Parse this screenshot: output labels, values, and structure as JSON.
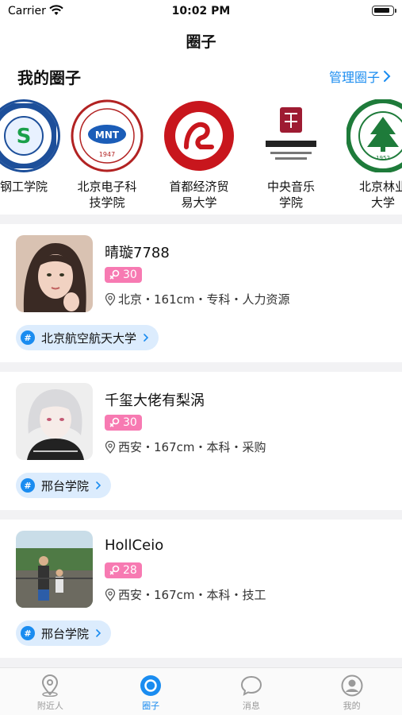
{
  "status_bar": {
    "carrier": "Carrier",
    "time": "10:02 PM"
  },
  "nav": {
    "title": "圈子"
  },
  "my_circles": {
    "title": "我的圈子",
    "manage_label": "管理圈子",
    "items": [
      {
        "name": "钢工学院",
        "logo": "university-seal-blue"
      },
      {
        "name": "北京电子科\n技学院",
        "logo": "university-seal-mnt"
      },
      {
        "name": "首都经济贸\n易大学",
        "logo": "university-seal-red"
      },
      {
        "name": "中央音乐\n学院",
        "logo": "conservatory-emblem"
      },
      {
        "name": "北京林业\n大学",
        "logo": "university-seal-green"
      }
    ]
  },
  "users": [
    {
      "name": "晴璇7788",
      "age": "30",
      "info": "北京・161cm・专科・人力资源",
      "school": "北京航空航天大学"
    },
    {
      "name": "千玺大佬有梨涡",
      "age": "30",
      "info": "西安・167cm・本科・采购",
      "school": "邢台学院"
    },
    {
      "name": "HollCeio",
      "age": "28",
      "info": "西安・167cm・本科・技工",
      "school": "邢台学院"
    }
  ],
  "tabs": [
    {
      "label": "附近人",
      "icon": "location-pin-icon",
      "active": false
    },
    {
      "label": "圈子",
      "icon": "circle-icon",
      "active": true
    },
    {
      "label": "消息",
      "icon": "chat-bubble-icon",
      "active": false
    },
    {
      "label": "我的",
      "icon": "user-icon",
      "active": false
    }
  ],
  "colors": {
    "accent": "#1a8cf0",
    "female_badge": "#f77ab2",
    "tag_bg": "#dcecfd"
  }
}
